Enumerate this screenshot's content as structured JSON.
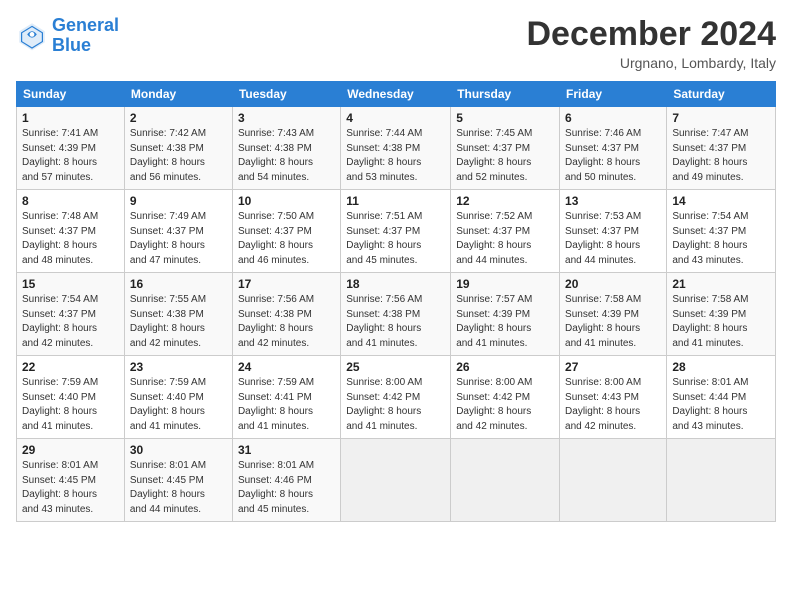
{
  "logo": {
    "text_general": "General",
    "text_blue": "Blue"
  },
  "title": "December 2024",
  "subtitle": "Urgnano, Lombardy, Italy",
  "header_days": [
    "Sunday",
    "Monday",
    "Tuesday",
    "Wednesday",
    "Thursday",
    "Friday",
    "Saturday"
  ],
  "weeks": [
    [
      {
        "day": "1",
        "info": "Sunrise: 7:41 AM\nSunset: 4:39 PM\nDaylight: 8 hours\nand 57 minutes."
      },
      {
        "day": "2",
        "info": "Sunrise: 7:42 AM\nSunset: 4:38 PM\nDaylight: 8 hours\nand 56 minutes."
      },
      {
        "day": "3",
        "info": "Sunrise: 7:43 AM\nSunset: 4:38 PM\nDaylight: 8 hours\nand 54 minutes."
      },
      {
        "day": "4",
        "info": "Sunrise: 7:44 AM\nSunset: 4:38 PM\nDaylight: 8 hours\nand 53 minutes."
      },
      {
        "day": "5",
        "info": "Sunrise: 7:45 AM\nSunset: 4:37 PM\nDaylight: 8 hours\nand 52 minutes."
      },
      {
        "day": "6",
        "info": "Sunrise: 7:46 AM\nSunset: 4:37 PM\nDaylight: 8 hours\nand 50 minutes."
      },
      {
        "day": "7",
        "info": "Sunrise: 7:47 AM\nSunset: 4:37 PM\nDaylight: 8 hours\nand 49 minutes."
      }
    ],
    [
      {
        "day": "8",
        "info": "Sunrise: 7:48 AM\nSunset: 4:37 PM\nDaylight: 8 hours\nand 48 minutes."
      },
      {
        "day": "9",
        "info": "Sunrise: 7:49 AM\nSunset: 4:37 PM\nDaylight: 8 hours\nand 47 minutes."
      },
      {
        "day": "10",
        "info": "Sunrise: 7:50 AM\nSunset: 4:37 PM\nDaylight: 8 hours\nand 46 minutes."
      },
      {
        "day": "11",
        "info": "Sunrise: 7:51 AM\nSunset: 4:37 PM\nDaylight: 8 hours\nand 45 minutes."
      },
      {
        "day": "12",
        "info": "Sunrise: 7:52 AM\nSunset: 4:37 PM\nDaylight: 8 hours\nand 44 minutes."
      },
      {
        "day": "13",
        "info": "Sunrise: 7:53 AM\nSunset: 4:37 PM\nDaylight: 8 hours\nand 44 minutes."
      },
      {
        "day": "14",
        "info": "Sunrise: 7:54 AM\nSunset: 4:37 PM\nDaylight: 8 hours\nand 43 minutes."
      }
    ],
    [
      {
        "day": "15",
        "info": "Sunrise: 7:54 AM\nSunset: 4:37 PM\nDaylight: 8 hours\nand 42 minutes."
      },
      {
        "day": "16",
        "info": "Sunrise: 7:55 AM\nSunset: 4:38 PM\nDaylight: 8 hours\nand 42 minutes."
      },
      {
        "day": "17",
        "info": "Sunrise: 7:56 AM\nSunset: 4:38 PM\nDaylight: 8 hours\nand 42 minutes."
      },
      {
        "day": "18",
        "info": "Sunrise: 7:56 AM\nSunset: 4:38 PM\nDaylight: 8 hours\nand 41 minutes."
      },
      {
        "day": "19",
        "info": "Sunrise: 7:57 AM\nSunset: 4:39 PM\nDaylight: 8 hours\nand 41 minutes."
      },
      {
        "day": "20",
        "info": "Sunrise: 7:58 AM\nSunset: 4:39 PM\nDaylight: 8 hours\nand 41 minutes."
      },
      {
        "day": "21",
        "info": "Sunrise: 7:58 AM\nSunset: 4:39 PM\nDaylight: 8 hours\nand 41 minutes."
      }
    ],
    [
      {
        "day": "22",
        "info": "Sunrise: 7:59 AM\nSunset: 4:40 PM\nDaylight: 8 hours\nand 41 minutes."
      },
      {
        "day": "23",
        "info": "Sunrise: 7:59 AM\nSunset: 4:40 PM\nDaylight: 8 hours\nand 41 minutes."
      },
      {
        "day": "24",
        "info": "Sunrise: 7:59 AM\nSunset: 4:41 PM\nDaylight: 8 hours\nand 41 minutes."
      },
      {
        "day": "25",
        "info": "Sunrise: 8:00 AM\nSunset: 4:42 PM\nDaylight: 8 hours\nand 41 minutes."
      },
      {
        "day": "26",
        "info": "Sunrise: 8:00 AM\nSunset: 4:42 PM\nDaylight: 8 hours\nand 42 minutes."
      },
      {
        "day": "27",
        "info": "Sunrise: 8:00 AM\nSunset: 4:43 PM\nDaylight: 8 hours\nand 42 minutes."
      },
      {
        "day": "28",
        "info": "Sunrise: 8:01 AM\nSunset: 4:44 PM\nDaylight: 8 hours\nand 43 minutes."
      }
    ],
    [
      {
        "day": "29",
        "info": "Sunrise: 8:01 AM\nSunset: 4:45 PM\nDaylight: 8 hours\nand 43 minutes."
      },
      {
        "day": "30",
        "info": "Sunrise: 8:01 AM\nSunset: 4:45 PM\nDaylight: 8 hours\nand 44 minutes."
      },
      {
        "day": "31",
        "info": "Sunrise: 8:01 AM\nSunset: 4:46 PM\nDaylight: 8 hours\nand 45 minutes."
      },
      {
        "day": "",
        "info": ""
      },
      {
        "day": "",
        "info": ""
      },
      {
        "day": "",
        "info": ""
      },
      {
        "day": "",
        "info": ""
      }
    ]
  ]
}
